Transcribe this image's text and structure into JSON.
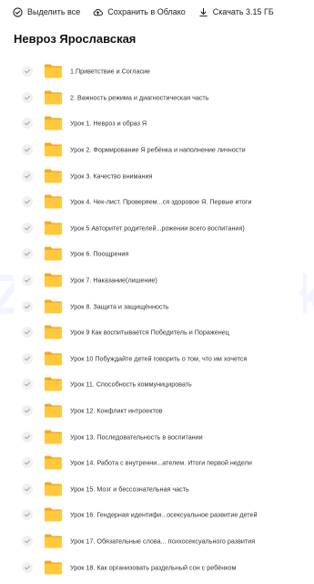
{
  "toolbar": {
    "select_all_label": "Выделить все",
    "save_to_cloud_label": "Сохранить в Облако",
    "download_label": "Скачать 3.15 ГБ",
    "select_all_icon": "check-circle-icon",
    "save_to_cloud_icon": "cloud-upload-icon",
    "download_icon": "download-icon"
  },
  "folder": {
    "title": "Невроз Ярославская"
  },
  "watermark": "ZnaniyaMarket",
  "items": [
    "1.Приветствие и Согласие",
    "2. Важность режима и диагностическая часть",
    "Урок 1. Невроз и образ Я",
    "Урок 2. Формирование Я ребёнка и наполнение личности",
    "Урок 3. Качество внимания",
    "Урок 4. Чек-лист. Проверяем...ся здоровое Я. Первые итоги",
    "Урок 5 Авторитет родителей...рожении всего воспитания)",
    "Урок 6. Поощрения",
    "Урок 7. Наказание(лишение)",
    "Урок 8. Защита и защищённость",
    "Урок 9 Как воспитывается Победитель и Пораженец",
    "Урок 10 Побуждайте детей говорить о том, что им хочется",
    "Урок 11. Способность коммуницировать",
    "Урок 12. Конфликт интроектов",
    "Урок 13. Последовательность в воспитании",
    "Урок 14. Работа с внутренни...ателем. Итоги первой недели",
    "Урок 15. Мозг и бессознательная часть",
    "Урок 16. Гендерная идентифи...осексуальное развитие детей",
    "Урок 17. Обязательные слова... психосексуального развития",
    "Урок 18. Как организовать раздельный сон с ребёнком"
  ],
  "colors": {
    "folder_body": "#FFC83D",
    "folder_tab": "#F5A623",
    "check_bg": "#EEF0F3",
    "check_mark": "#9AA0A8",
    "watermark": "#CFD8FF"
  }
}
